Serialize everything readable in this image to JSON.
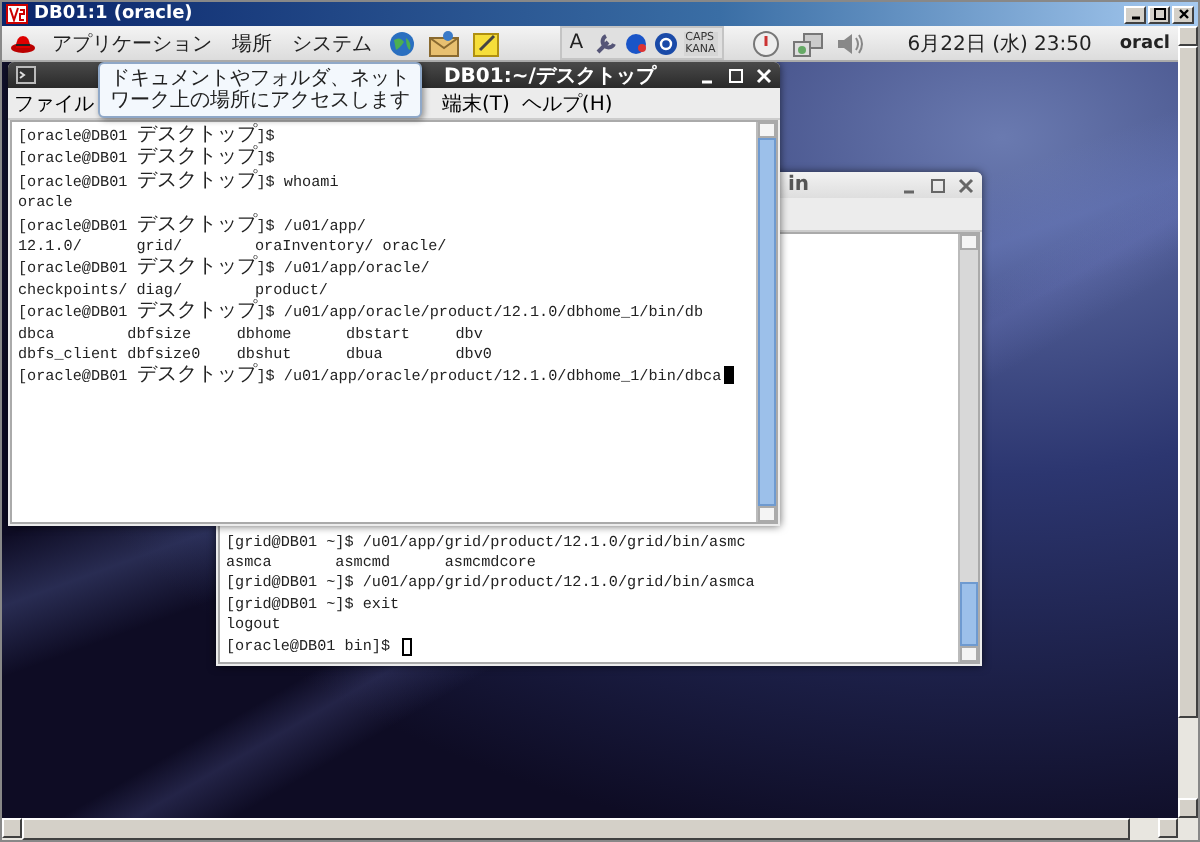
{
  "window": {
    "title": "DB01:1 (oracle)"
  },
  "panel": {
    "menus": [
      "アプリケーション",
      "場所",
      "システム"
    ],
    "input_method": "A",
    "keyboard_indicators": [
      "CAPS",
      "KANA"
    ],
    "clock": "6月22日 (水) 23:50",
    "user": "oracl"
  },
  "tooltip": {
    "lines": [
      "ドキュメントやフォルダ、ネット",
      "ワーク上の場所にアクセスします"
    ]
  },
  "terminals": [
    {
      "title": "DB01:~/デスクトップ",
      "focused": true,
      "menu": [
        "ファイル",
        "端末(T)",
        "ヘルプ(H)"
      ],
      "lines": [
        "[oracle@DB01 デスクトップ]$",
        "[oracle@DB01 デスクトップ]$",
        "[oracle@DB01 デスクトップ]$ whoami",
        "oracle",
        "[oracle@DB01 デスクトップ]$ /u01/app/",
        "12.1.0/      grid/        oraInventory/ oracle/",
        "[oracle@DB01 デスクトップ]$ /u01/app/oracle/",
        "checkpoints/ diag/        product/",
        "[oracle@DB01 デスクトップ]$ /u01/app/oracle/product/12.1.0/dbhome_1/bin/db",
        "dbca        dbfsize     dbhome      dbstart     dbv",
        "dbfs_client dbfsize0    dbshut      dbua        dbv0",
        "[oracle@DB01 デスクトップ]$ /u01/app/oracle/product/12.1.0/dbhome_1/bin/dbca"
      ]
    },
    {
      "title": "in",
      "focused": false,
      "lines": [
        "[grid@DB01 ~]$ /u01/app/grid/product/12.1.0/grid/bin/asmc",
        "asmca       asmcmd      asmcmdcore",
        "[grid@DB01 ~]$ /u01/app/grid/product/12.1.0/grid/bin/asmca",
        "[grid@DB01 ~]$ exit",
        "logout",
        "[oracle@DB01 bin]$ "
      ]
    }
  ]
}
